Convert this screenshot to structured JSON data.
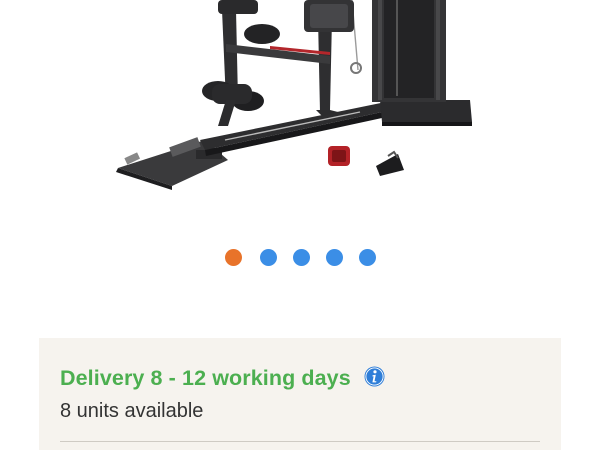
{
  "product": {
    "image_alt": "home multi-gym machine with leg curl attachment, ankle strap and cable handle"
  },
  "carousel": {
    "total_slides": 5,
    "active_index": 0,
    "active_color": "#e8732a",
    "inactive_color": "#3b8ee6"
  },
  "delivery": {
    "title": "Delivery 8 - 12 working days",
    "title_color": "#4caf50",
    "info_icon": "info-icon",
    "availability": "8 units available"
  }
}
